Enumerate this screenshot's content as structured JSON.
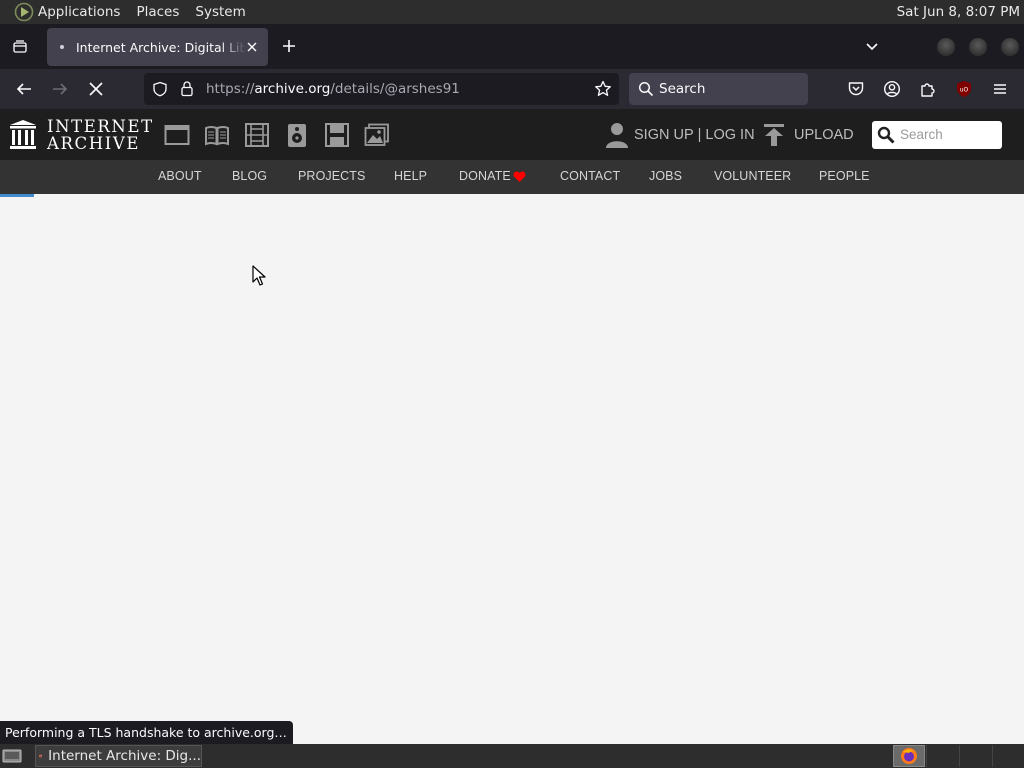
{
  "system_panel": {
    "menus": [
      "Applications",
      "Places",
      "System"
    ],
    "clock": "Sat Jun  8,  8:07 PM"
  },
  "browser": {
    "tab": {
      "title": "Internet Archive: Digital Library of Free & Borrowable Books, Movies, Music & Wayback Machine"
    },
    "url": {
      "prefix": "https://",
      "host": "archive.org",
      "path": "/details/@arshes91"
    },
    "search_placeholder": "Search",
    "status_text": "Performing a TLS handshake to archive.org…",
    "extension_badge": "uO"
  },
  "archive": {
    "logo": {
      "line1": "INTERNET",
      "line2": "ARCHIVE"
    },
    "media_icons": [
      "web-icon",
      "texts-icon",
      "video-icon",
      "audio-icon",
      "software-icon",
      "images-icon"
    ],
    "account": {
      "signup": "SIGN UP",
      "separator": "|",
      "login": "LOG IN"
    },
    "upload": "UPLOAD",
    "search_placeholder": "Search",
    "nav": [
      "ABOUT",
      "BLOG",
      "PROJECTS",
      "HELP",
      "DONATE",
      "CONTACT",
      "JOBS",
      "VOLUNTEER",
      "PEOPLE"
    ],
    "donate_heart_color": "#ff0000",
    "accent_color": "#428bca"
  },
  "taskbar": {
    "task_label": "Internet Archive: Dig..."
  }
}
